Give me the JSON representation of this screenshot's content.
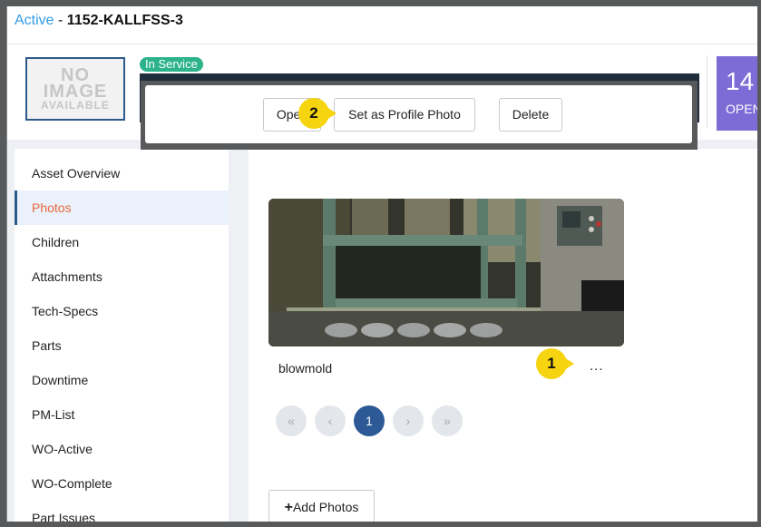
{
  "page": {
    "status": "Active",
    "separator": " - ",
    "asset_id": "1152-KALLFSS-3"
  },
  "header": {
    "no_image": [
      "NO",
      "IMAGE",
      "AVAILABLE"
    ],
    "service_badge": "In Service",
    "kpi_number": "14",
    "kpi_label": "OPEN"
  },
  "sidebar": {
    "items": [
      {
        "label": "Asset Overview"
      },
      {
        "label": "Photos"
      },
      {
        "label": "Children"
      },
      {
        "label": "Attachments"
      },
      {
        "label": "Tech-Specs"
      },
      {
        "label": "Parts"
      },
      {
        "label": "Downtime"
      },
      {
        "label": "PM-List"
      },
      {
        "label": "WO-Active"
      },
      {
        "label": "WO-Complete"
      },
      {
        "label": "Part Issues"
      }
    ],
    "active_index": 1
  },
  "photos": {
    "items": [
      {
        "caption": "blowmold",
        "more": "..."
      }
    ],
    "pager": {
      "first": "«",
      "prev": "‹",
      "current": "1",
      "next": "›",
      "last": "»"
    },
    "add_label": "Add Photos",
    "add_icon": "+"
  },
  "popup": {
    "open_label": "Open",
    "profile_label": "Set as Profile Photo",
    "delete_label": "Delete"
  },
  "callouts": [
    {
      "number": "1"
    },
    {
      "number": "2"
    }
  ],
  "colors": {
    "status": "#2f9be6",
    "badge": "#2db38c",
    "kpi": "#7d6bd6",
    "active_nav_text": "#e8693a",
    "pager_current": "#2d5a97",
    "callout": "#f6d40f"
  }
}
